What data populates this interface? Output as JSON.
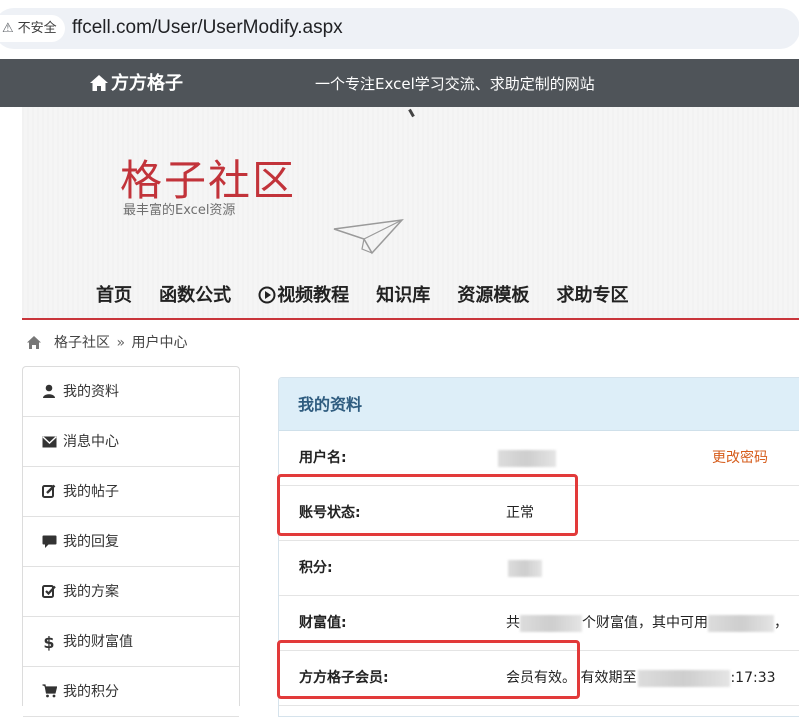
{
  "browser": {
    "security_label": "不安全",
    "url": "ffcell.com/User/UserModify.aspx"
  },
  "topbar": {
    "brand": "方方格子",
    "slogan": "一个专注Excel学习交流、求助定制的网站"
  },
  "banner": {
    "title": "格子社区",
    "subtitle": "最丰富的Excel资源"
  },
  "nav": {
    "items": [
      "首页",
      "函数公式",
      "视频教程",
      "知识库",
      "资源模板",
      "求助专区"
    ]
  },
  "breadcrumb": {
    "root": "格子社区",
    "separator": "»",
    "current": "用户中心"
  },
  "sidebar": {
    "items": [
      {
        "label": "我的资料",
        "icon": "user-icon"
      },
      {
        "label": "消息中心",
        "icon": "envelope-icon"
      },
      {
        "label": "我的帖子",
        "icon": "edit-icon"
      },
      {
        "label": "我的回复",
        "icon": "comment-icon"
      },
      {
        "label": "我的方案",
        "icon": "check-square-icon"
      },
      {
        "label": "我的财富值",
        "icon": "dollar-icon"
      },
      {
        "label": "我的积分",
        "icon": "cart-icon"
      }
    ]
  },
  "profile": {
    "heading": "我的资料",
    "rows": {
      "username": {
        "label": "用户名:",
        "action": "更改密码"
      },
      "status": {
        "label": "账号状态:",
        "value": "正常"
      },
      "points": {
        "label": "积分:"
      },
      "wealth": {
        "label": "财富值:",
        "prefix": "共",
        "middle": "个财富值，其中可用",
        "suffix": "，"
      },
      "member": {
        "label": "方方格子会员:",
        "value": "会员有效。 有效期至",
        "time": ":17:33"
      }
    }
  },
  "colors": {
    "topbar": "#4f5459",
    "accent_red": "#c2333a",
    "panel_head": "#ddeef8",
    "link_orange": "#d65d1c",
    "highlight": "#e23a3a"
  }
}
